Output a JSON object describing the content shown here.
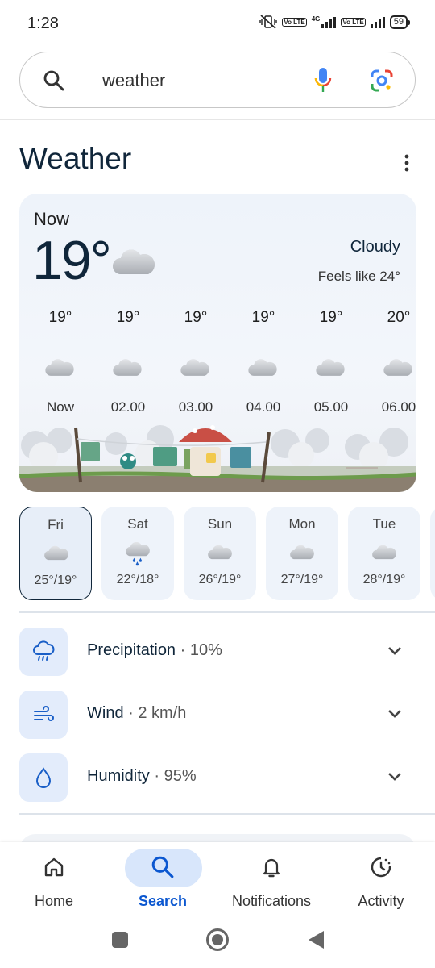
{
  "status_bar": {
    "time": "1:28",
    "network": "4G",
    "lte1": "Vo LTE",
    "lte2": "Vo LTE",
    "battery": "59"
  },
  "search": {
    "query": "weather",
    "search_icon": "search-icon",
    "mic_icon": "microphone-icon",
    "lens_icon": "google-lens-icon"
  },
  "weather": {
    "title": "Weather",
    "now_label": "Now",
    "current_temp": "19°",
    "condition": "Cloudy",
    "feels_like": "Feels like 24°",
    "hourly": [
      {
        "temp": "19°",
        "time": "Now",
        "icon": "cloud-icon"
      },
      {
        "temp": "19°",
        "time": "02.00",
        "icon": "cloud-icon"
      },
      {
        "temp": "19°",
        "time": "03.00",
        "icon": "cloud-icon"
      },
      {
        "temp": "19°",
        "time": "04.00",
        "icon": "cloud-icon"
      },
      {
        "temp": "19°",
        "time": "05.00",
        "icon": "cloud-icon"
      },
      {
        "temp": "20°",
        "time": "06.00",
        "icon": "cloud-icon"
      }
    ],
    "daily": [
      {
        "day": "Fri",
        "range": "25°/19°",
        "icon": "cloud-icon",
        "selected": true
      },
      {
        "day": "Sat",
        "range": "22°/18°",
        "icon": "rain-cloud-icon",
        "selected": false
      },
      {
        "day": "Sun",
        "range": "26°/19°",
        "icon": "cloud-icon",
        "selected": false
      },
      {
        "day": "Mon",
        "range": "27°/19°",
        "icon": "cloud-icon",
        "selected": false
      },
      {
        "day": "Tue",
        "range": "28°/19°",
        "icon": "cloud-icon",
        "selected": false
      }
    ],
    "details": [
      {
        "label": "Precipitation",
        "value": "10%",
        "icon": "precipitation-icon"
      },
      {
        "label": "Wind",
        "value": "2 km/h",
        "icon": "wind-icon"
      },
      {
        "label": "Humidity",
        "value": "95%",
        "icon": "humidity-drop-icon"
      }
    ],
    "separator": "·"
  },
  "bottom_nav": {
    "items": [
      {
        "label": "Home",
        "icon": "home-icon",
        "active": false
      },
      {
        "label": "Search",
        "icon": "search-icon",
        "active": true
      },
      {
        "label": "Notifications",
        "icon": "bell-icon",
        "active": false
      },
      {
        "label": "Activity",
        "icon": "activity-icon",
        "active": false
      }
    ]
  },
  "colors": {
    "accent": "#0b57d0",
    "title": "#10263a",
    "card_bg": "#eef3fa",
    "chip_bg": "#e3ecfb"
  }
}
